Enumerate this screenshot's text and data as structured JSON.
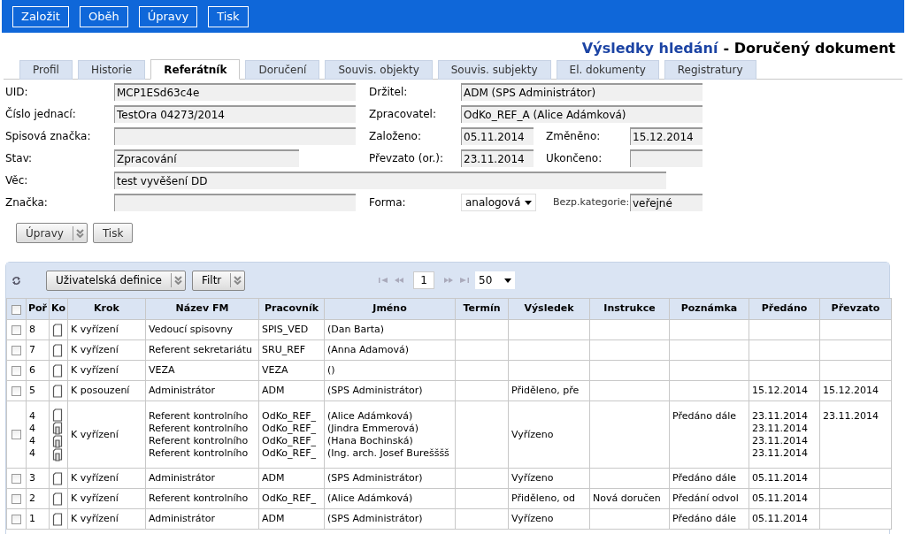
{
  "top_buttons": [
    "Založit",
    "Oběh",
    "Úpravy",
    "Tisk"
  ],
  "heading": {
    "breadcrumb": "Výsledky hledání",
    "title": "- Doručený dokument"
  },
  "tabs": [
    {
      "label": "Profil",
      "selected": false
    },
    {
      "label": "Historie",
      "selected": false
    },
    {
      "label": "Referátník",
      "selected": true
    },
    {
      "label": "Doručení",
      "selected": false
    },
    {
      "label": "Souvis. objekty",
      "selected": false
    },
    {
      "label": "Souvis. subjekty",
      "selected": false
    },
    {
      "label": "El. dokumenty",
      "selected": false
    },
    {
      "label": "Registratury",
      "selected": false
    }
  ],
  "form": [
    [
      {
        "label": "UID:",
        "value": "MCP1ESd63c4e",
        "kind": "text"
      },
      {
        "label": "Držitel:",
        "value": "ADM (SPS Administrátor)",
        "kind": "text"
      }
    ],
    [
      {
        "label": "Číslo jednací:",
        "value": "TestOra 04273/2014",
        "kind": "text"
      },
      {
        "label": "Zpracovatel:",
        "value": "OdKo_REF_A (Alice Adámková)",
        "kind": "text"
      }
    ],
    [
      {
        "label": "Spisová značka:",
        "kind": "text"
      },
      {
        "label": "Založeno:",
        "value": "05.11.2014",
        "kind": "text"
      },
      {
        "label": "Změněno:",
        "value": "15.12.2014",
        "kind": "text"
      }
    ],
    [
      {
        "label": "Stav:",
        "value": "Zpracování",
        "kind": "text"
      },
      {
        "label": "Převzato (or.):",
        "value": "23.11.2014",
        "kind": "text"
      },
      {
        "label": "Ukončeno:",
        "kind": "text"
      }
    ],
    [
      {
        "label": "Věc:",
        "value": "test vyvěšení DD",
        "kind": "text"
      }
    ],
    [
      {
        "label": "Značka:",
        "kind": "text"
      },
      {
        "label": "Forma:",
        "value": "analogová",
        "kind": "select"
      },
      {
        "label": "Bezp.kategorie:",
        "value": "veřejné",
        "kind": "text"
      }
    ]
  ],
  "actions": [
    {
      "label": "Úpravy",
      "kind": "menu"
    },
    {
      "label": "Tisk",
      "kind": "plain"
    }
  ],
  "grid": {
    "toolbar": [
      {
        "label": "Uživatelská definice"
      },
      {
        "label": "Filtr"
      }
    ],
    "pager": {
      "page": "1",
      "page_size": "50"
    },
    "header_checked": false,
    "columns": [
      "Poř",
      "Ko",
      "Krok",
      "Název FM",
      "Pracovník",
      "Jméno",
      "Termín",
      "Výsledek",
      "Instrukce",
      "Poznámka",
      "Předáno",
      "Převzato"
    ],
    "rows": [
      {
        "checked": false,
        "order": [
          "8"
        ],
        "icons": [
          {
            "kind": "page"
          }
        ],
        "step": "K vyřízení",
        "fm": [
          "Vedoucí spisovny"
        ],
        "worker": [
          "SPIS_VED"
        ],
        "name": [
          "(Dan Barta)"
        ]
      },
      {
        "checked": false,
        "order": [
          "7"
        ],
        "icons": [
          {
            "kind": "page"
          }
        ],
        "step": "K vyřízení",
        "fm": [
          "Referent sekretariátu"
        ],
        "worker": [
          "SRU_REF"
        ],
        "name": [
          "(Anna Adamová)"
        ]
      },
      {
        "checked": false,
        "order": [
          "6"
        ],
        "icons": [
          {
            "kind": "page"
          }
        ],
        "step": "K vyřízení",
        "fm": [
          "VEZA"
        ],
        "worker": [
          "VEZA"
        ],
        "name": [
          "()"
        ]
      },
      {
        "checked": false,
        "order": [
          "5"
        ],
        "icons": [
          {
            "kind": "page"
          }
        ],
        "step": "K posouzení",
        "fm": [
          "Administrátor"
        ],
        "worker": [
          "ADM"
        ],
        "name": [
          "(SPS Administrátor)"
        ],
        "result": "Přiděleno, pře",
        "handed": [
          "15.12.2014"
        ],
        "taken": "15.12.2014"
      },
      {
        "checked": false,
        "order": [
          "4",
          "4",
          "4",
          "4"
        ],
        "icons": [
          {
            "kind": "page"
          },
          {
            "kind": "stack"
          },
          {
            "kind": "stack"
          },
          {
            "kind": "stack"
          }
        ],
        "step": "K vyřízení",
        "fm": [
          "Referent kontrolního",
          "Referent kontrolního",
          "Referent kontrolního",
          "Referent kontrolního"
        ],
        "worker": [
          "OdKo_REF_",
          "OdKo_REF_",
          "OdKo_REF_",
          "OdKo_REF_"
        ],
        "name": [
          "(Alice Adámková)",
          "(Jindra Emmerová)",
          "(Hana Bochinská)",
          "(Ing. arch. Josef Burešššš"
        ],
        "result": "Vyřízeno",
        "note": "Předáno dále",
        "handed": [
          "23.11.2014",
          "23.11.2014",
          "23.11.2014",
          "23.11.2014"
        ],
        "taken": "23.11.2014"
      },
      {
        "checked": false,
        "order": [
          "3"
        ],
        "icons": [
          {
            "kind": "page"
          }
        ],
        "step": "K vyřízení",
        "fm": [
          "Administrátor"
        ],
        "worker": [
          "ADM"
        ],
        "name": [
          "(SPS Administrátor)"
        ],
        "result": "Vyřízeno",
        "note": "Předáno dále",
        "handed": [
          "05.11.2014"
        ]
      },
      {
        "checked": false,
        "order": [
          "2"
        ],
        "icons": [
          {
            "kind": "page"
          }
        ],
        "step": "K vyřízení",
        "fm": [
          "Referent kontrolního"
        ],
        "worker": [
          "OdKo_REF_"
        ],
        "name": [
          "(Alice Adámková)"
        ],
        "result": "Přiděleno, od",
        "instruction": "Nová doručen",
        "note": "Předání odvol",
        "handed": [
          "05.11.2014"
        ]
      },
      {
        "checked": false,
        "order": [
          "1"
        ],
        "icons": [
          {
            "kind": "page"
          }
        ],
        "step": "K vyřízení",
        "fm": [
          "Administrátor"
        ],
        "worker": [
          "ADM"
        ],
        "name": [
          "(SPS Administrátor)"
        ],
        "result": "Vyřízeno",
        "note": "Předáno dále",
        "handed": [
          "05.11.2014"
        ]
      }
    ]
  }
}
